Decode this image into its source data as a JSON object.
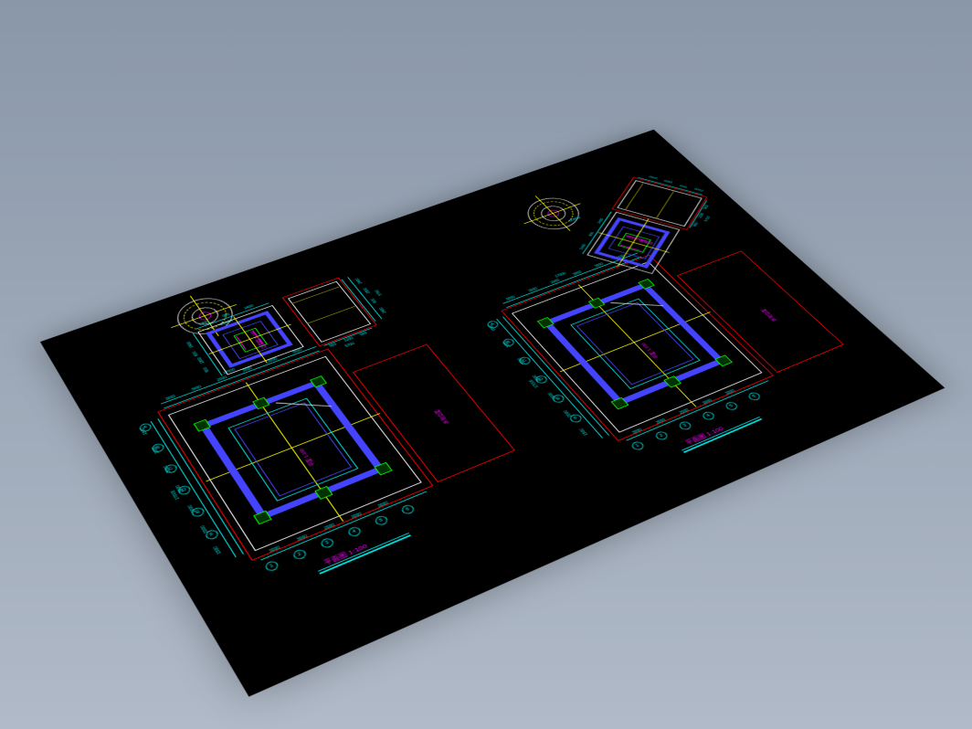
{
  "sheet_left": {
    "title": "平面图 1:100",
    "panel_label": "立面图 1:100",
    "side_label": "水池立面",
    "plan_label": "平面 1:100",
    "dims_top": [
      "3000",
      "3000",
      "2000",
      "3000",
      "3000",
      "3000"
    ],
    "dims_top_total": "17000",
    "dims_left": [
      "1500",
      "3000",
      "3000",
      "3000",
      "3000",
      "2000",
      "1500"
    ],
    "dims_left_total": "17000",
    "dims_mid": [
      "900",
      "1200",
      "900"
    ],
    "grids_h": [
      "A",
      "B",
      "C",
      "D",
      "E",
      "F"
    ],
    "grids_v": [
      "1",
      "2",
      "3",
      "4",
      "5",
      "6"
    ],
    "upper_dims_h": [
      "2400",
      "900",
      "2400"
    ],
    "upper_dims_v": [
      "2400",
      "600",
      "1800",
      "900",
      "2400"
    ],
    "upper_total_h": "5700",
    "upper_total_v": "5700",
    "circle_dia": "Ø3600"
  },
  "sheet_right": {
    "title": "平面图 1:100",
    "panel_label": "立面图 1:100",
    "side_label": "水池立面",
    "plan_label": "平面 1:100",
    "dims_top": [
      "3000",
      "3000",
      "2000",
      "3000",
      "3000",
      "3000"
    ],
    "dims_top_total": "17000",
    "dims_left": [
      "1500",
      "3000",
      "3000",
      "3000",
      "3000",
      "2000",
      "1500"
    ],
    "dims_left_total": "17000",
    "dims_mid": [
      "900",
      "1200",
      "900"
    ],
    "grids_h": [
      "A",
      "B",
      "C",
      "D",
      "E",
      "F"
    ],
    "grids_v": [
      "1",
      "2",
      "3",
      "4",
      "5",
      "6"
    ],
    "upper_dims_h": [
      "2400",
      "900",
      "2400"
    ],
    "upper_dims_v": [
      "2400",
      "600",
      "1800",
      "900",
      "2400"
    ],
    "upper_total_h": "5700",
    "upper_total_v": "5700",
    "circle_dia": "Ø3600",
    "rot_angle": -35
  }
}
